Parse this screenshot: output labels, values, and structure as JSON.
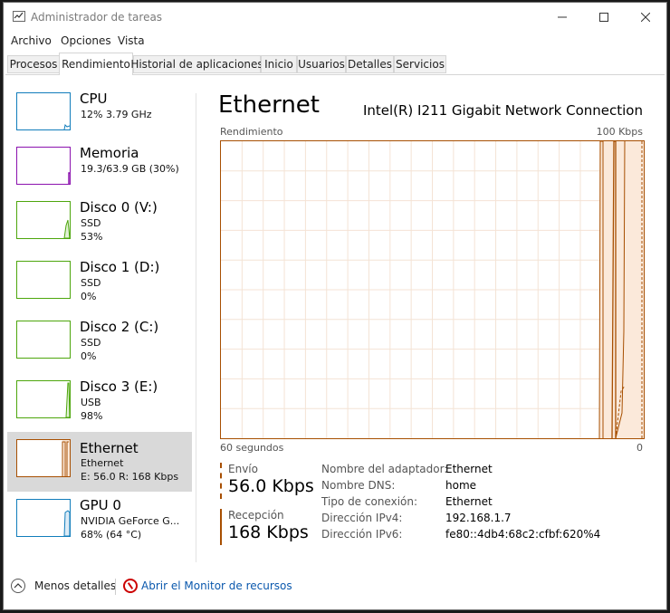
{
  "window": {
    "title": "Administrador de tareas"
  },
  "menu": [
    "Archivo",
    "Opciones",
    "Vista"
  ],
  "tabs": [
    "Procesos",
    "Rendimiento",
    "Historial de aplicaciones",
    "Inicio",
    "Usuarios",
    "Detalles",
    "Servicios"
  ],
  "sidebar": [
    {
      "name": "CPU",
      "line1": "12% 3.79 GHz",
      "color": "#117dbb"
    },
    {
      "name": "Memoria",
      "line1": "19.3/63.9 GB (30%)",
      "color": "#8b12ae"
    },
    {
      "name": "Disco 0 (V:)",
      "line1": "SSD",
      "line2": "53%",
      "color": "#4da60c"
    },
    {
      "name": "Disco 1 (D:)",
      "line1": "SSD",
      "line2": "0%",
      "color": "#4da60c"
    },
    {
      "name": "Disco 2 (C:)",
      "line1": "SSD",
      "line2": "0%",
      "color": "#4da60c"
    },
    {
      "name": "Disco 3 (E:)",
      "line1": "USB",
      "line2": "98%",
      "color": "#4da60c"
    },
    {
      "name": "Ethernet",
      "line1": "Ethernet",
      "line2": "E: 56.0 R: 168 Kbps",
      "color": "#a74f01"
    },
    {
      "name": "GPU 0",
      "line1": "NVIDIA GeForce G...",
      "line2": "68% (64 °C)",
      "color": "#117dbb"
    }
  ],
  "detail": {
    "title": "Ethernet",
    "device": "Intel(R) I211 Gigabit Network Connection",
    "graph_label": "Rendimiento",
    "graph_max": "100 Kbps",
    "axis_left": "60 segundos",
    "axis_right": "0",
    "send_label": "Envío",
    "send_value": "56.0 Kbps",
    "recv_label": "Recepción",
    "recv_value": "168 Kbps",
    "info": [
      {
        "key": "Nombre del adaptador:",
        "value": "Ethernet"
      },
      {
        "key": "Nombre DNS:",
        "value": "home"
      },
      {
        "key": "Tipo de conexión:",
        "value": "Ethernet"
      },
      {
        "key": "Dirección IPv4:",
        "value": "192.168.1.7"
      },
      {
        "key": "Dirección IPv6:",
        "value": "fe80::4db4:68c2:cfbf:620%4"
      }
    ]
  },
  "footer": {
    "less": "Menos detalles",
    "monitor": "Abrir el Monitor de recursos"
  },
  "colors": {
    "ethernet": "#a74f01",
    "link": "#0a58ad"
  }
}
